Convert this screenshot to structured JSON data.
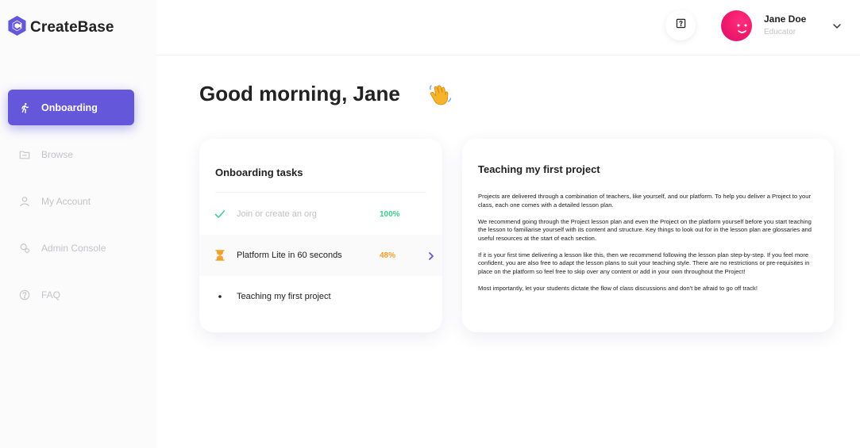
{
  "app": {
    "name": "CreateBase"
  },
  "sidebar": {
    "items": [
      {
        "label": "Onboarding",
        "icon": "walking-person-icon",
        "active": true
      },
      {
        "label": "Browse",
        "icon": "folder-icon",
        "active": false
      },
      {
        "label": "My Account",
        "icon": "user-icon",
        "active": false
      },
      {
        "label": "Admin Console",
        "icon": "gear-person-icon",
        "active": false
      },
      {
        "label": "FAQ",
        "icon": "question-circle-icon",
        "active": false
      }
    ]
  },
  "topbar": {
    "help_icon": "help-box-icon",
    "user": {
      "name": "Jane Doe",
      "role": "Educator"
    }
  },
  "main": {
    "greeting": "Good morning, Jane",
    "greeting_emoji": "waving-hand-icon",
    "tasks": {
      "title": "Onboarding tasks",
      "items": [
        {
          "label": "Join or create an org",
          "percent": "100%",
          "status": "done",
          "percent_value": 1.0
        },
        {
          "label": "Platform Lite in 60 seconds",
          "percent": "48%",
          "status": "in-progress",
          "percent_value": 0.48
        },
        {
          "label": "Teaching my first project",
          "percent": "",
          "status": "todo"
        }
      ]
    },
    "project": {
      "title": "Teaching my first project",
      "paragraphs": [
        "Projects are delivered through a combination of teachers, like yourself, and our platform. To help you deliver a Project to your class, each one comes with a detailed lesson plan.",
        "We recommend going through the Project lesson plan and even the Project on the platform yourself before you start teaching the lesson to familiarise yourself with its content and structure. Key things to look out for in the lesson plan are glossaries and useful resources at the start of each section.",
        "If it is your first time delivering a lesson like this, then we recommend following the lesson plan step-by-step. If you feel more confident, you are also free to adapt the lesson plans to suit your teaching style. There are no restrictions or pre-requisites in place on the platform so feel free to skip over any content or add in your own throughout the Project!",
        "Most importantly, let your students dictate the flow of class discussions and don't be afraid to go off track!"
      ]
    }
  },
  "colors": {
    "accent": "#6457d9",
    "done": "#3dce8c",
    "in_progress": "#f5a02c",
    "muted": "#c4c4c8",
    "avatar": "#f0196c"
  }
}
